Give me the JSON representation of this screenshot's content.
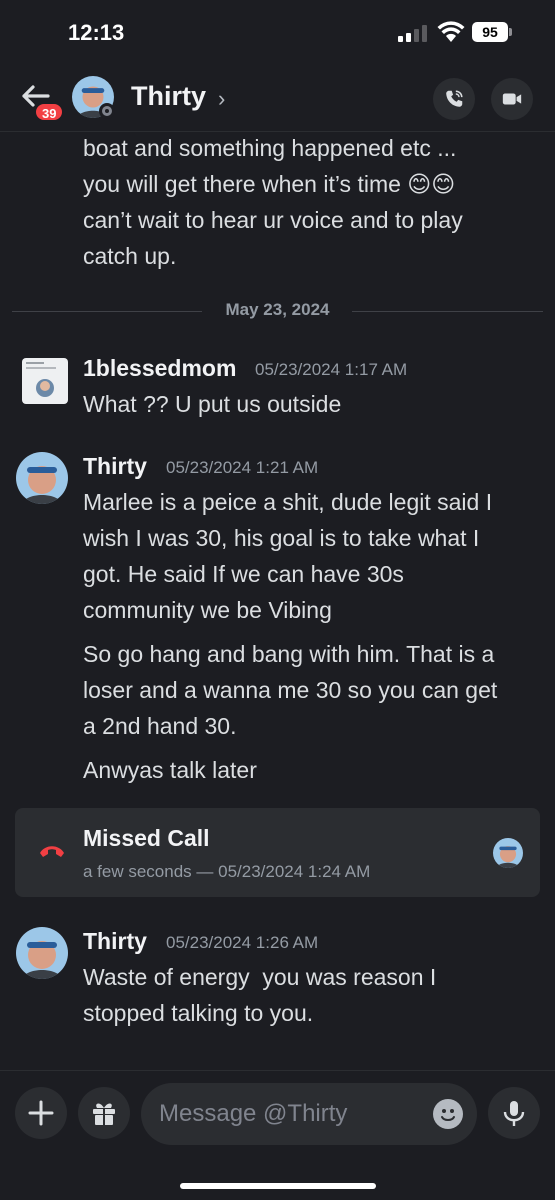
{
  "status_bar": {
    "time": "12:13",
    "battery": "95"
  },
  "header": {
    "unread_badge": "39",
    "name": "Thirty",
    "chevron": "›"
  },
  "prev_message_lines": [
    "boat and something happened etc ...",
    "you will get there when it’s time 😊😊",
    "can’t wait to hear ur voice and to play",
    "catch up."
  ],
  "date_divider": "May 23, 2024",
  "messages": [
    {
      "author": "1blessedmom",
      "timestamp": "05/23/2024 1:17 AM",
      "lines": [
        "What ?? U put us outside"
      ]
    },
    {
      "author": "Thirty",
      "timestamp": "05/23/2024 1:21 AM",
      "paragraphs": [
        [
          "Marlee is a peice a shit, dude legit said I",
          "wish I was 30, his goal is to take what I",
          "got. He said If we can have 30s",
          "community we be Vibing"
        ],
        [
          "So go hang and bang with him. That is a",
          "loser and a wanna me 30 so you can get",
          "a 2nd hand 30."
        ],
        [
          "Anwyas talk later"
        ]
      ]
    },
    {
      "author": "Thirty",
      "timestamp": "05/23/2024 1:26 AM",
      "lines": [
        "Waste of energy  you was reason I",
        "stopped talking to you."
      ]
    }
  ],
  "missed_call": {
    "title": "Missed Call",
    "subtitle": "a few seconds — 05/23/2024 1:24 AM"
  },
  "composer": {
    "placeholder": "Message @Thirty"
  },
  "colors": {
    "background": "#1c1d22",
    "card": "#2b2d31",
    "danger": "#f23f43",
    "muted": "#949ba4"
  },
  "icons": [
    "back-arrow-icon",
    "phone-call-icon",
    "video-call-icon",
    "missed-call-icon",
    "plus-icon",
    "gift-icon",
    "emoji-icon",
    "microphone-icon"
  ]
}
